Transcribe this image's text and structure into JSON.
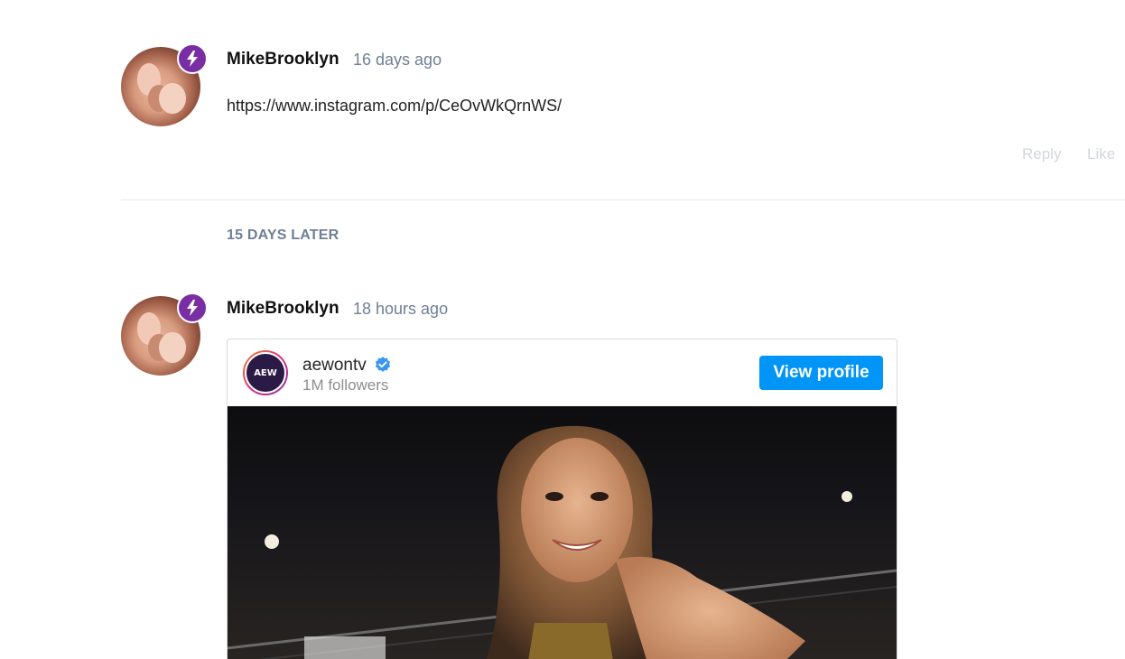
{
  "comments": [
    {
      "username": "MikeBrooklyn",
      "time": "16 days ago",
      "text": "https://www.instagram.com/p/CeOvWkQrnWS/",
      "actions": {
        "reply": "Reply",
        "like": "Like"
      }
    },
    {
      "username": "MikeBrooklyn",
      "time": "18 hours ago"
    }
  ],
  "gap_label": "15 DAYS LATER",
  "embed": {
    "account": "aewontv",
    "followers": "1M followers",
    "view_profile": "View profile",
    "logo_text": "AEW"
  },
  "colors": {
    "badge": "#7a2ea3",
    "timestamp": "#6e7f96",
    "instagram_button": "#0095f6",
    "verified": "#3897f0"
  },
  "icons": {
    "badge": "lightning-bolt-icon",
    "verified": "verified-check-icon"
  }
}
